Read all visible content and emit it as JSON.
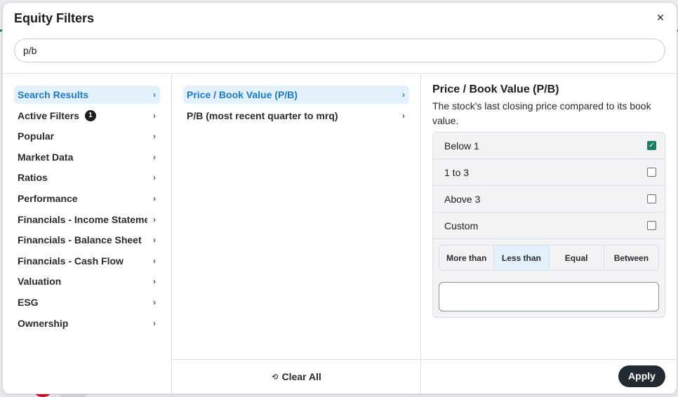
{
  "dialog": {
    "title": "Equity Filters",
    "close_label": "×"
  },
  "search": {
    "value": "p/b",
    "placeholder": ""
  },
  "left_nav": {
    "items": [
      {
        "label": "Search Results",
        "chevron": "›"
      },
      {
        "label": "Active Filters",
        "badge": "1",
        "chevron": "›"
      },
      {
        "label": "Popular",
        "chevron": "›"
      },
      {
        "label": "Market Data",
        "chevron": "›"
      },
      {
        "label": "Ratios",
        "chevron": "›"
      },
      {
        "label": "Performance",
        "chevron": "›"
      },
      {
        "label": "Financials - Income Statement",
        "chevron": "›"
      },
      {
        "label": "Financials - Balance Sheet",
        "chevron": "›"
      },
      {
        "label": "Financials - Cash Flow",
        "chevron": "›"
      },
      {
        "label": "Valuation",
        "chevron": "›"
      },
      {
        "label": "ESG",
        "chevron": "›"
      },
      {
        "label": "Ownership",
        "chevron": "›"
      }
    ]
  },
  "results": {
    "items": [
      {
        "label": "Price / Book Value (P/B)",
        "chevron": "›"
      },
      {
        "label": "P/B (most recent quarter to mrq)",
        "chevron": "›"
      }
    ],
    "clear_all_label": "Clear All",
    "clear_icon": "reset-icon"
  },
  "detail": {
    "title": "Price / Book Value (P/B)",
    "description": "The stock's last closing price compared to its book value.",
    "options": [
      {
        "label": "Below 1",
        "checked": true
      },
      {
        "label": "1 to 3",
        "checked": false
      },
      {
        "label": "Above 3",
        "checked": false
      },
      {
        "label": "Custom",
        "checked": false
      }
    ],
    "operators": [
      "More than",
      "Less than",
      "Equal",
      "Between"
    ],
    "selected_operator": "Less than",
    "custom_value": "",
    "apply_label": "Apply"
  },
  "colors": {
    "accent_blue": "#1a7ad4",
    "active_bg": "#e3f1fd",
    "check_green": "#1a7f64",
    "apply_bg": "#232a31"
  }
}
